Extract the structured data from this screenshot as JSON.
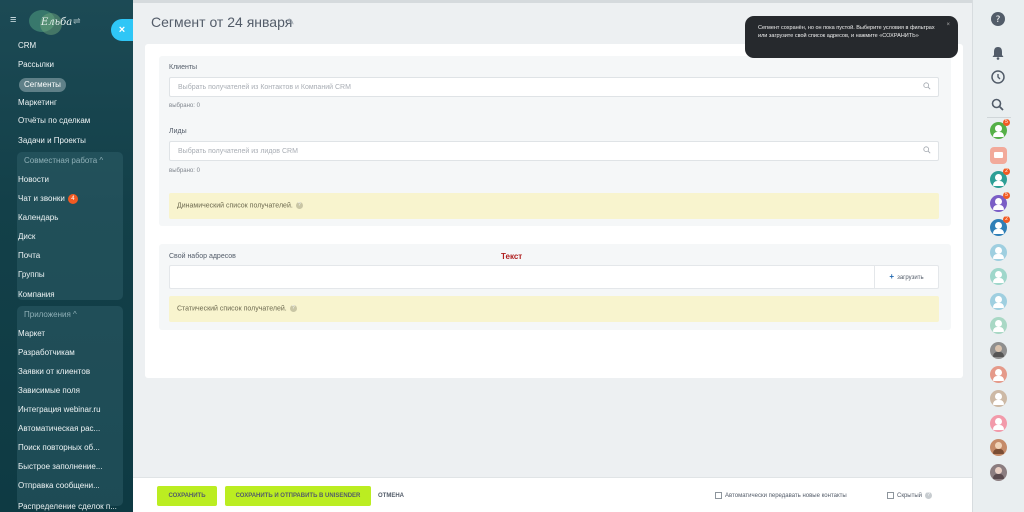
{
  "sidebar": {
    "logo_text": "Ельба",
    "items": [
      {
        "label": "CRM"
      },
      {
        "label": "Рассылки"
      },
      {
        "label": "Сегменты"
      },
      {
        "label": "Маркетинг"
      },
      {
        "label": "Отчёты по сделкам"
      },
      {
        "label": "Задачи и Проекты"
      },
      {
        "label": "Совместная работа ^"
      },
      {
        "label": "Новости"
      },
      {
        "label": "Чат и звонки",
        "badge": "4"
      },
      {
        "label": "Календарь"
      },
      {
        "label": "Диск"
      },
      {
        "label": "Почта"
      },
      {
        "label": "Группы"
      },
      {
        "label": "Компания"
      },
      {
        "label": "Приложения ^"
      },
      {
        "label": "Маркет"
      },
      {
        "label": "Разработчикам"
      },
      {
        "label": "Заявки от клиентов"
      },
      {
        "label": "Зависимые поля"
      },
      {
        "label": "Интеграция webinar.ru"
      },
      {
        "label": "Автоматическая рас..."
      },
      {
        "label": "Поиск повторных об..."
      },
      {
        "label": "Быстрое заполнение..."
      },
      {
        "label": "Отправка сообщени..."
      },
      {
        "label": "Распределение сделок п..."
      }
    ]
  },
  "page": {
    "title": "Сегмент от 24 января"
  },
  "form": {
    "clients": {
      "label": "Клиенты",
      "placeholder": "Выбрать получателей из Контактов и Компаний CRM",
      "selected": "выбрано: 0"
    },
    "leads": {
      "label": "Лиды",
      "placeholder": "Выбрать получателей из лидов CRM",
      "selected": "выбрано: 0"
    },
    "dynamic_note": "Динамический список получателей.",
    "own_addresses": {
      "label": "Свой набор адресов",
      "upload": "загрузить",
      "annotation": "Текст"
    },
    "static_note": "Статический список получателей."
  },
  "footer": {
    "save": "СОХРАНИТЬ",
    "save_send": "СОХРАНИТЬ И ОТПРАВИТЬ В UNISENDER",
    "cancel": "ОТМЕНА",
    "auto_transfer": "Автоматически передавать новые контакты",
    "hidden": "Скрытый"
  },
  "tooltip": {
    "text": "Сегмент сохранён, но он пока пустой. Выберите условия в фильтрах или загрузите свой список адресов, и нажмите «СОХРАНИТЬ»",
    "close": "×"
  },
  "rightbar": {
    "avatars": [
      {
        "color": "#55b047",
        "badge": "5"
      },
      {
        "color": "#f2aa9b",
        "badge": ""
      },
      {
        "color": "#2d9f96",
        "badge": "2"
      },
      {
        "color": "#7b5ec6",
        "badge": "5"
      },
      {
        "color": "#2f7fb7",
        "badge": "2"
      },
      {
        "color": "#9fcfe0",
        "badge": ""
      },
      {
        "color": "#9fd7cb",
        "badge": ""
      },
      {
        "color": "#9fcfe0",
        "badge": ""
      },
      {
        "color": "#a9d8c5",
        "badge": ""
      },
      {
        "color": "#8f8f8f",
        "badge": ""
      },
      {
        "color": "#e59a8a",
        "badge": ""
      },
      {
        "color": "#cdb9a5",
        "badge": ""
      },
      {
        "color": "#f29aaa",
        "badge": ""
      },
      {
        "color": "#c58b69",
        "badge": ""
      },
      {
        "color": "#8b7d80",
        "badge": ""
      }
    ]
  }
}
